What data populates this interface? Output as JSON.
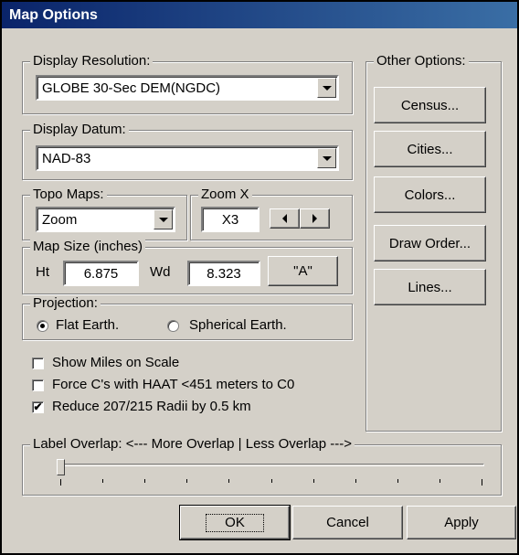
{
  "window": {
    "title": "Map Options"
  },
  "display_resolution": {
    "legend": "Display Resolution:",
    "selected": "GLOBE 30-Sec DEM(NGDC)"
  },
  "display_datum": {
    "legend": "Display Datum:",
    "selected": "NAD-83"
  },
  "topo_maps": {
    "legend": "Topo Maps:",
    "selected": "Zoom"
  },
  "zoom": {
    "legend": "Zoom X",
    "value": "X3"
  },
  "map_size": {
    "legend": "Map Size (inches)",
    "ht_label": "Ht",
    "ht_value": "6.875",
    "wd_label": "Wd",
    "wd_value": "8.323",
    "button_label": "\"A\""
  },
  "projection": {
    "legend": "Projection:",
    "options": [
      {
        "label": "Flat Earth.",
        "selected": true
      },
      {
        "label": "Spherical Earth.",
        "selected": false
      }
    ]
  },
  "checkboxes": [
    {
      "label": "Show Miles on Scale",
      "checked": false
    },
    {
      "label": "Force C's with HAAT <451 meters to C0",
      "checked": false
    },
    {
      "label": "Reduce 207/215 Radii by 0.5 km",
      "checked": true
    }
  ],
  "label_overlap": {
    "legend": "Label Overlap:  <--- More Overlap | Less Overlap --->",
    "slider_value": 0,
    "slider_min": 0,
    "slider_max": 10
  },
  "other_options": {
    "legend": "Other Options:",
    "buttons": [
      "Census...",
      "Cities...",
      "Colors...",
      "Draw Order...",
      "Lines..."
    ]
  },
  "footer": {
    "ok_label": "OK",
    "cancel_label": "Cancel",
    "apply_label": "Apply"
  }
}
